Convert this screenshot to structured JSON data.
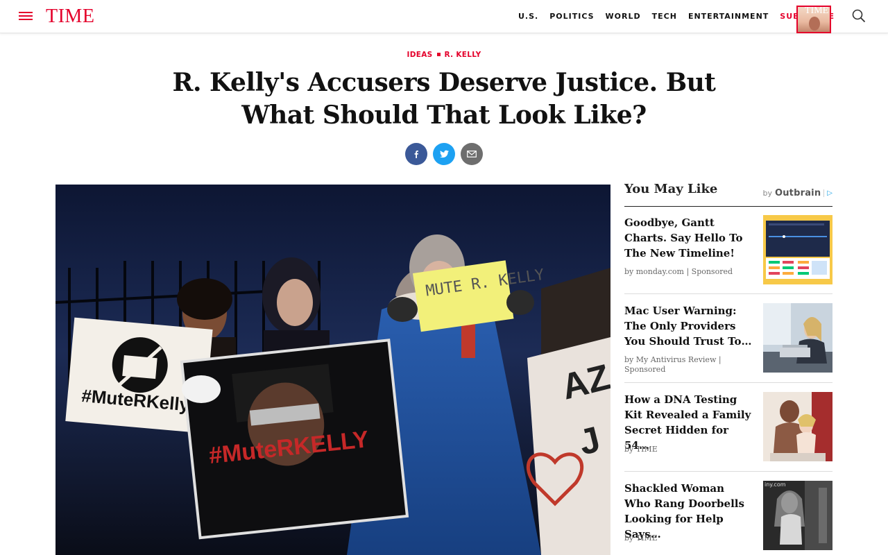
{
  "header": {
    "logo": "TIME",
    "nav": [
      "U.S.",
      "POLITICS",
      "WORLD",
      "TECH",
      "ENTERTAINMENT"
    ],
    "subscribe": "SUBSCRIBE",
    "cover_word": "TIME"
  },
  "article": {
    "kicker_section": "IDEAS",
    "kicker_topic": "R. KELLY",
    "headline": "R. Kelly's Accusers Deserve Justice. But What Should That Look Like?",
    "photo_signs": {
      "mute_sign": "MUTE R. KELLY",
      "hashtag_small": "#MuteRKelly",
      "hashtag_big": "#MuteRKELLY"
    }
  },
  "sidebar": {
    "heading": "You May Like",
    "by": "by",
    "provider": "Outbrain",
    "items": [
      {
        "title": "Goodbye, Gantt Charts. Say Hello To The New Timeline!",
        "source": "by monday.com | Sponsored"
      },
      {
        "title": "Mac User Warning: The Only Providers You Should Trust To…",
        "source": "by My Antivirus Review | Sponsored"
      },
      {
        "title": "How a DNA Testing Kit Revealed a Family Secret Hidden for 54…",
        "source": "by TIME"
      },
      {
        "title": "Shackled Woman Who Rang Doorbells Looking for Help Says…",
        "source": "by TIME",
        "thumb_watermark": "iny.com"
      }
    ]
  },
  "colors": {
    "brand_red": "#e4002b",
    "facebook": "#3b5998",
    "twitter": "#1da1f2",
    "email": "#6e6e6e"
  }
}
